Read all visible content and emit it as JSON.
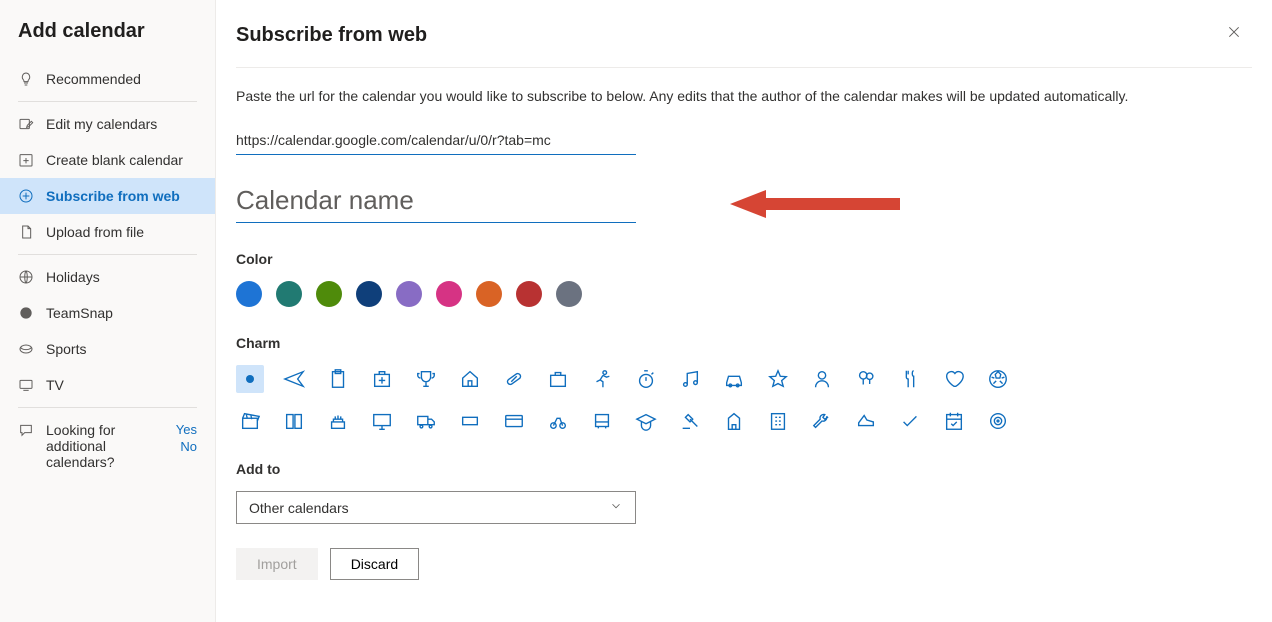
{
  "sidebar": {
    "title": "Add calendar",
    "items": [
      {
        "label": "Recommended",
        "icon": "bulb"
      },
      {
        "label": "Edit my calendars",
        "icon": "edit-cal"
      },
      {
        "label": "Create blank calendar",
        "icon": "plus-cal"
      },
      {
        "label": "Subscribe from web",
        "icon": "web",
        "selected": true
      },
      {
        "label": "Upload from file",
        "icon": "file"
      },
      {
        "label": "Holidays",
        "icon": "globe"
      },
      {
        "label": "TeamSnap",
        "icon": "teamsnap"
      },
      {
        "label": "Sports",
        "icon": "sports"
      },
      {
        "label": "TV",
        "icon": "tv"
      }
    ],
    "looking": {
      "text": "Looking for additional calendars?",
      "yes": "Yes",
      "no": "No"
    }
  },
  "main": {
    "title": "Subscribe from web",
    "desc": "Paste the url for the calendar you would like to subscribe to below. Any edits that the author of the calendar makes will be updated automatically.",
    "url_value": "https://calendar.google.com/calendar/u/0/r?tab=mc",
    "name_placeholder": "Calendar name",
    "name_value": "",
    "labels": {
      "color": "Color",
      "charm": "Charm",
      "add_to": "Add to"
    },
    "colors": [
      "#1e74d5",
      "#217a72",
      "#4f8b0b",
      "#0f3f7a",
      "#886cc4",
      "#d63384",
      "#d96325",
      "#b83232",
      "#6b7280"
    ],
    "charms": [
      "dot",
      "airplane",
      "clipboard",
      "firstaid",
      "trophy",
      "home",
      "pill",
      "briefcase",
      "running",
      "stopwatch",
      "music",
      "car",
      "star",
      "person",
      "balloons",
      "fork",
      "heart",
      "soccer",
      "clapboard",
      "book",
      "cake",
      "monitor",
      "truck",
      "ticket",
      "creditcard",
      "bicycle",
      "bus",
      "gradcap",
      "gavel",
      "building",
      "apartment",
      "wrench",
      "shoe",
      "checkmark",
      "calendar",
      "target"
    ],
    "add_to_value": "Other calendars",
    "buttons": {
      "import": "Import",
      "discard": "Discard"
    }
  }
}
